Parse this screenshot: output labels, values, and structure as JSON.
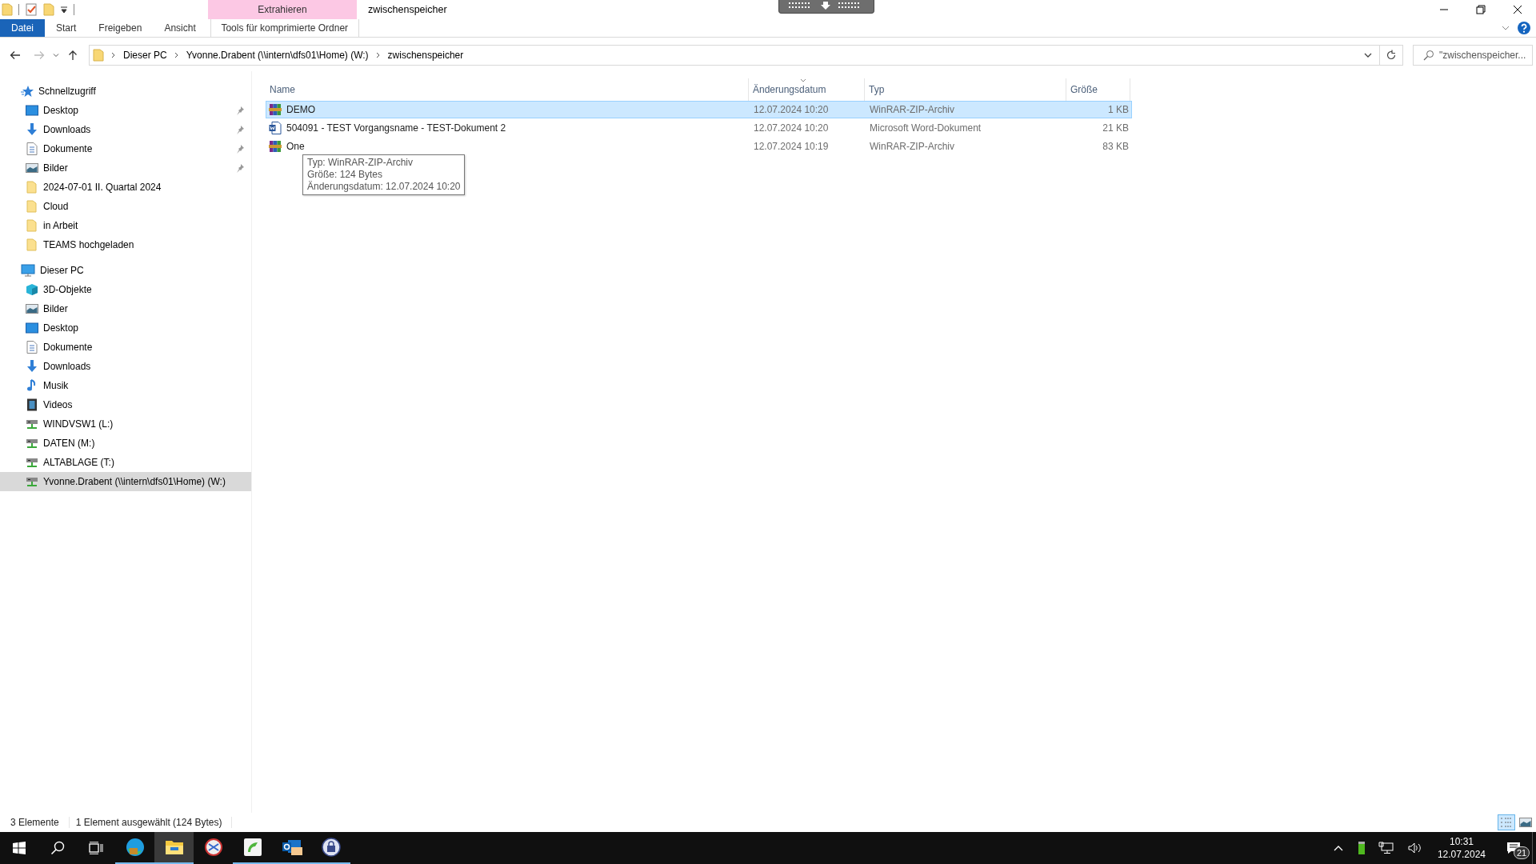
{
  "window": {
    "title": "zwischenspeicher",
    "context_group": "Extrahieren"
  },
  "ribbon_tabs": [
    {
      "label": "Datei",
      "kind": "file"
    },
    {
      "label": "Start",
      "kind": "plain"
    },
    {
      "label": "Freigeben",
      "kind": "plain"
    },
    {
      "label": "Ansicht",
      "kind": "plain"
    },
    {
      "label": "Tools für komprimierte Ordner",
      "kind": "context"
    }
  ],
  "breadcrumbs": [
    "Dieser PC",
    "Yvonne.Drabent (\\\\intern\\dfs01\\Home) (W:)",
    "zwischenspeicher"
  ],
  "search": {
    "placeholder": "\"zwischenspeicher..."
  },
  "sidebar": {
    "sections": [
      {
        "label": "Schnellzugriff",
        "kind": "star",
        "selected": false,
        "children": [
          {
            "label": "Desktop",
            "kind": "desktop",
            "pinned": true,
            "selected": false
          },
          {
            "label": "Downloads",
            "kind": "download",
            "pinned": true,
            "selected": false
          },
          {
            "label": "Dokumente",
            "kind": "document",
            "pinned": true,
            "selected": false
          },
          {
            "label": "Bilder",
            "kind": "pictures",
            "pinned": true,
            "selected": false
          },
          {
            "label": "2024-07-01 II. Quartal 2024",
            "kind": "folder",
            "pinned": false,
            "selected": false
          },
          {
            "label": "Cloud",
            "kind": "folder",
            "pinned": false,
            "selected": false
          },
          {
            "label": "in Arbeit",
            "kind": "folder",
            "pinned": false,
            "selected": false
          },
          {
            "label": "TEAMS hochgeladen",
            "kind": "folder",
            "pinned": false,
            "selected": false
          }
        ]
      },
      {
        "label": "Dieser PC",
        "kind": "pc",
        "selected": false,
        "children": [
          {
            "label": "3D-Objekte",
            "kind": "cube",
            "pinned": false,
            "selected": false
          },
          {
            "label": "Bilder",
            "kind": "pictures",
            "pinned": false,
            "selected": false
          },
          {
            "label": "Desktop",
            "kind": "desktop",
            "pinned": false,
            "selected": false
          },
          {
            "label": "Dokumente",
            "kind": "document",
            "pinned": false,
            "selected": false
          },
          {
            "label": "Downloads",
            "kind": "download",
            "pinned": false,
            "selected": false
          },
          {
            "label": "Musik",
            "kind": "music",
            "pinned": false,
            "selected": false
          },
          {
            "label": "Videos",
            "kind": "video",
            "pinned": false,
            "selected": false
          },
          {
            "label": "WINDVSW1 (L:)",
            "kind": "drive",
            "pinned": false,
            "selected": false
          },
          {
            "label": "DATEN (M:)",
            "kind": "drive",
            "pinned": false,
            "selected": false
          },
          {
            "label": "ALTABLAGE (T:)",
            "kind": "drive",
            "pinned": false,
            "selected": false
          },
          {
            "label": "Yvonne.Drabent (\\\\intern\\dfs01\\Home) (W:)",
            "kind": "drive",
            "pinned": false,
            "selected": true
          }
        ]
      }
    ]
  },
  "columns": [
    {
      "label": "Name",
      "sorted": false
    },
    {
      "label": "Änderungsdatum",
      "sorted": true
    },
    {
      "label": "Typ",
      "sorted": false
    },
    {
      "label": "Größe",
      "sorted": false
    }
  ],
  "files": [
    {
      "name": "DEMO",
      "date": "12.07.2024 10:20",
      "type": "WinRAR-ZIP-Archiv",
      "size": "1 KB",
      "kind": "archive",
      "selected": true
    },
    {
      "name": "504091 - TEST Vorgangsname - TEST-Dokument 2",
      "date": "12.07.2024 10:20",
      "type": "Microsoft Word-Dokument",
      "size": "21 KB",
      "kind": "word",
      "selected": false
    },
    {
      "name": "One",
      "date": "12.07.2024 10:19",
      "type": "WinRAR-ZIP-Archiv",
      "size": "83 KB",
      "kind": "archive",
      "selected": false
    }
  ],
  "tooltip": {
    "lines": [
      "Typ: WinRAR-ZIP-Archiv",
      "Größe: 124 Bytes",
      "Änderungsdatum: 12.07.2024 10:20"
    ]
  },
  "status_bar": {
    "count": "3 Elemente",
    "selection": "1 Element ausgewählt (124 Bytes)"
  },
  "view_buttons": [
    {
      "kind": "details",
      "selected": true
    },
    {
      "kind": "large",
      "selected": false
    }
  ],
  "taskbar": {
    "apps": [
      {
        "kind": "edge",
        "running": true,
        "active": false
      },
      {
        "kind": "explorer",
        "running": true,
        "active": true
      },
      {
        "kind": "scissors",
        "running": false,
        "active": false
      },
      {
        "kind": "green",
        "running": true,
        "active": false
      },
      {
        "kind": "outlook",
        "running": true,
        "active": false
      },
      {
        "kind": "lock",
        "running": true,
        "active": false
      }
    ],
    "time": "10:31",
    "date": "12.07.2024",
    "notifications": "21"
  }
}
